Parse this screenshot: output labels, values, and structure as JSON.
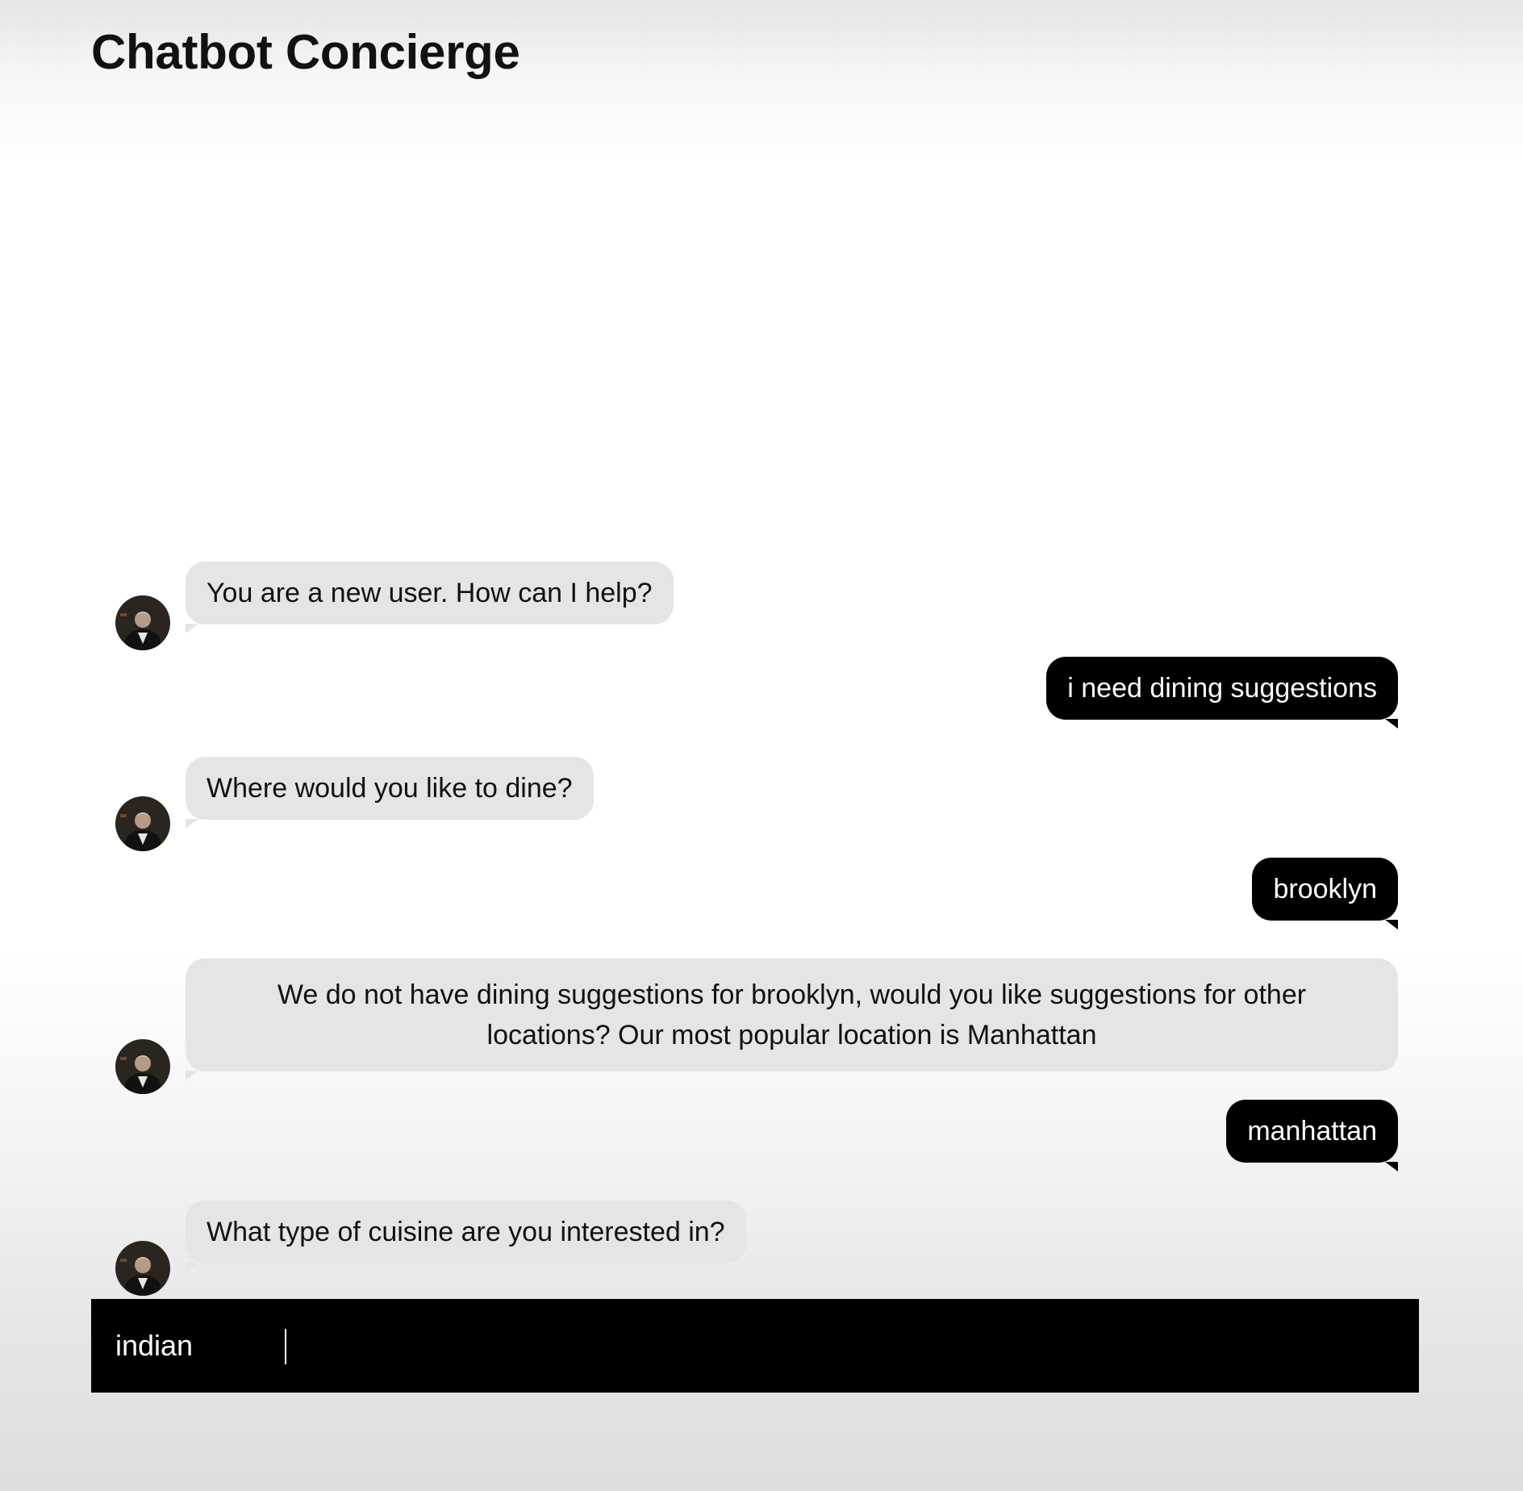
{
  "app": {
    "title": "Chatbot Concierge"
  },
  "messages": [
    {
      "sender": "bot",
      "text": "You are a new user. How can I help?"
    },
    {
      "sender": "user",
      "text": "i need dining suggestions"
    },
    {
      "sender": "bot",
      "text": "Where would you like to dine?"
    },
    {
      "sender": "user",
      "text": "brooklyn"
    },
    {
      "sender": "bot",
      "text": "We do not have dining suggestions for brooklyn, would you like suggestions for other locations? Our most popular location is Manhattan"
    },
    {
      "sender": "user",
      "text": "manhattan"
    },
    {
      "sender": "bot",
      "text": "What type of cuisine are you interested in?"
    }
  ],
  "composer": {
    "value": "indian"
  },
  "colors": {
    "bot_bubble": "#e5e5e5",
    "user_bubble": "#000000",
    "composer_bg": "#000000"
  },
  "icons": {
    "bot_avatar": "concierge-avatar-icon"
  }
}
